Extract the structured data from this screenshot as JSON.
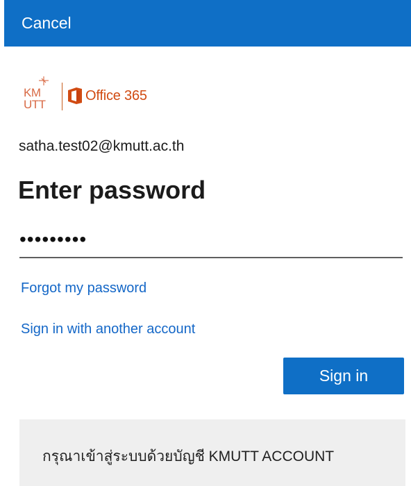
{
  "header": {
    "cancel_label": "Cancel"
  },
  "branding": {
    "kmutt_logo_text": "KMUTT",
    "office_logo_text": "Office 365"
  },
  "account": {
    "email": "satha.test02@kmutt.ac.th"
  },
  "page": {
    "title": "Enter password"
  },
  "password": {
    "masked_value": "•••••••••"
  },
  "links": {
    "forgot_password": "Forgot my password",
    "another_account": "Sign in with another account"
  },
  "actions": {
    "sign_in_label": "Sign in"
  },
  "notice": {
    "text": "กรุณาเข้าสู่ระบบด้วยบัญชี KMUTT ACCOUNT"
  },
  "colors": {
    "primary_blue": "#0f6fc6",
    "link_blue": "#1467c7",
    "office_orange": "#d14b12"
  },
  "icons": {
    "office": "office-icon",
    "kmutt_logo": "kmutt-logo-icon"
  }
}
